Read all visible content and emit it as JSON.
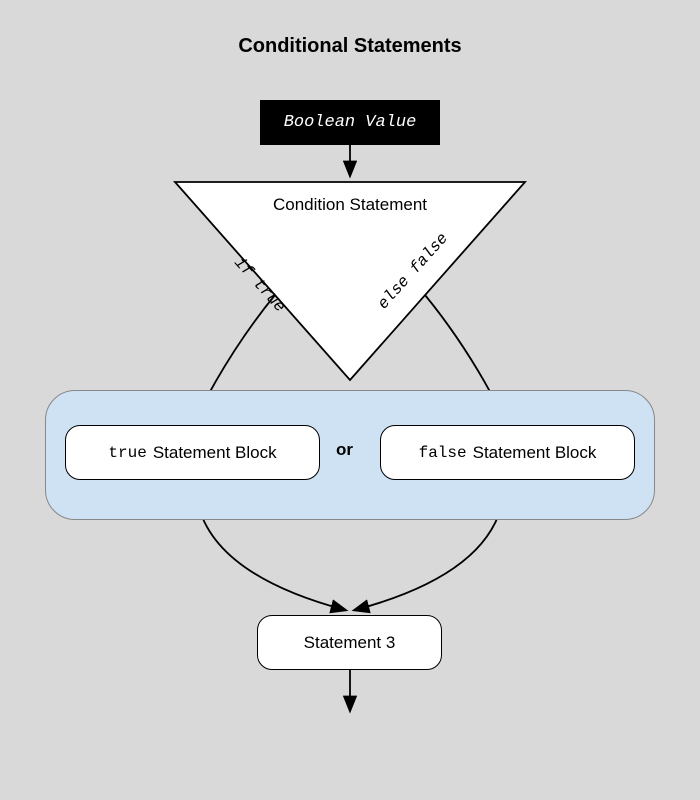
{
  "title": "Conditional Statements",
  "boolean_value": "Boolean Value",
  "condition": "Condition Statement",
  "if_true": "if true",
  "else_false": "else false",
  "or": "or",
  "true_label": "true",
  "false_label": "false",
  "block_suffix": " Statement Block",
  "stmt3": "Statement 3"
}
